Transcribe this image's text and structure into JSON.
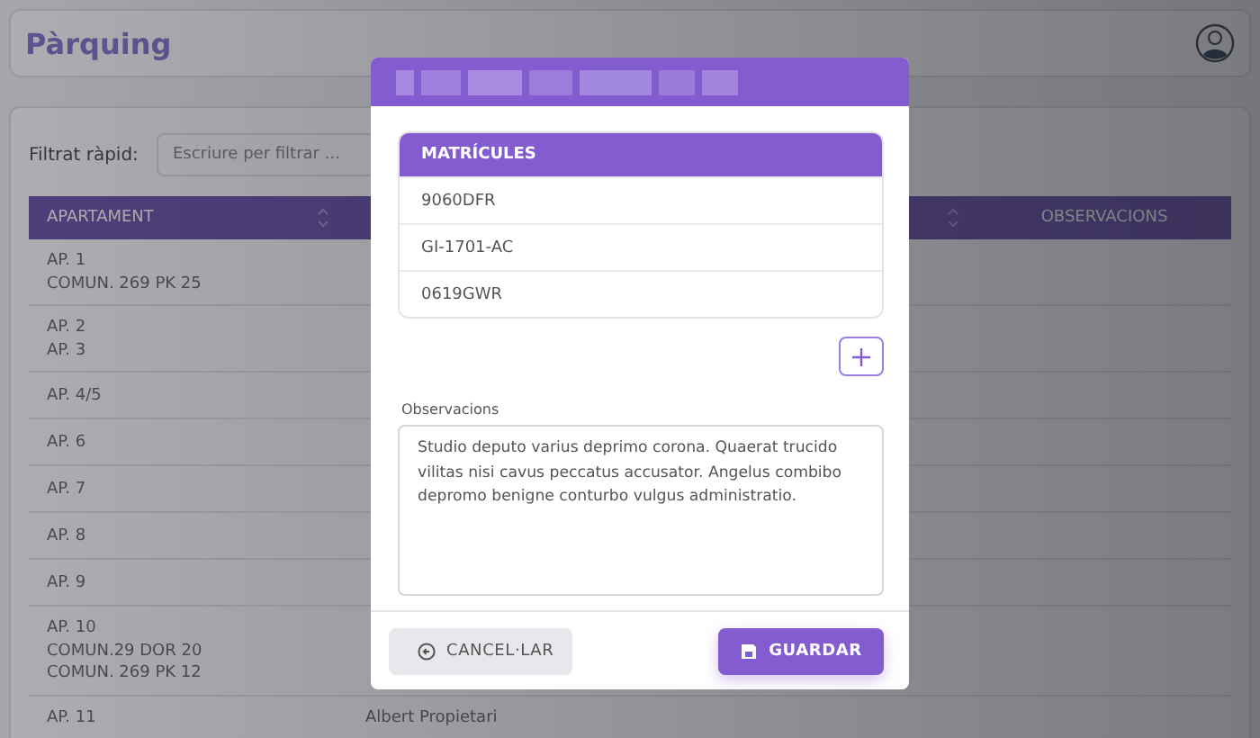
{
  "page": {
    "title": "Pàrquing"
  },
  "filter": {
    "label": "Filtrat ràpid:",
    "placeholder": "Escriure per filtrar ..."
  },
  "table": {
    "columns": [
      {
        "label": "APARTAMENT",
        "sortable": true
      },
      {
        "sortable": true
      },
      {
        "label": "OBSERVACIONS",
        "sortable": false
      }
    ],
    "rows": [
      {
        "apartament": [
          "AP. 1",
          "COMUN. 269 PK 25"
        ]
      },
      {
        "apartament": [
          "AP. 2",
          "AP. 3"
        ]
      },
      {
        "apartament": [
          "AP. 4/5"
        ]
      },
      {
        "apartament": [
          "AP. 6"
        ]
      },
      {
        "apartament": [
          "AP. 7"
        ]
      },
      {
        "apartament": [
          "AP. 8"
        ]
      },
      {
        "apartament": [
          "AP. 9"
        ]
      },
      {
        "apartament": [
          "AP. 10",
          "COMUN.29 DOR 20",
          "COMUN. 269 PK 12"
        ]
      },
      {
        "apartament": [
          "AP. 11"
        ],
        "column_2": "Albert Propietari"
      }
    ]
  },
  "modal": {
    "licence_plates": {
      "heading": "MATRÍCULES",
      "items": [
        "9060DFR",
        "GI-1701-AC",
        "0619GWR"
      ]
    },
    "observations": {
      "label": "Observacions",
      "value": "Studio deputo varius deprimo corona. Quaerat trucido vilitas nisi cavus peccatus accusator. Angelus combibo depromo benigne conturbo vulgus administratio."
    },
    "buttons": [
      {
        "label": "CANCEL·LAR",
        "kind": "secondary"
      },
      {
        "label": "GUARDAR",
        "kind": "primary"
      }
    ]
  }
}
